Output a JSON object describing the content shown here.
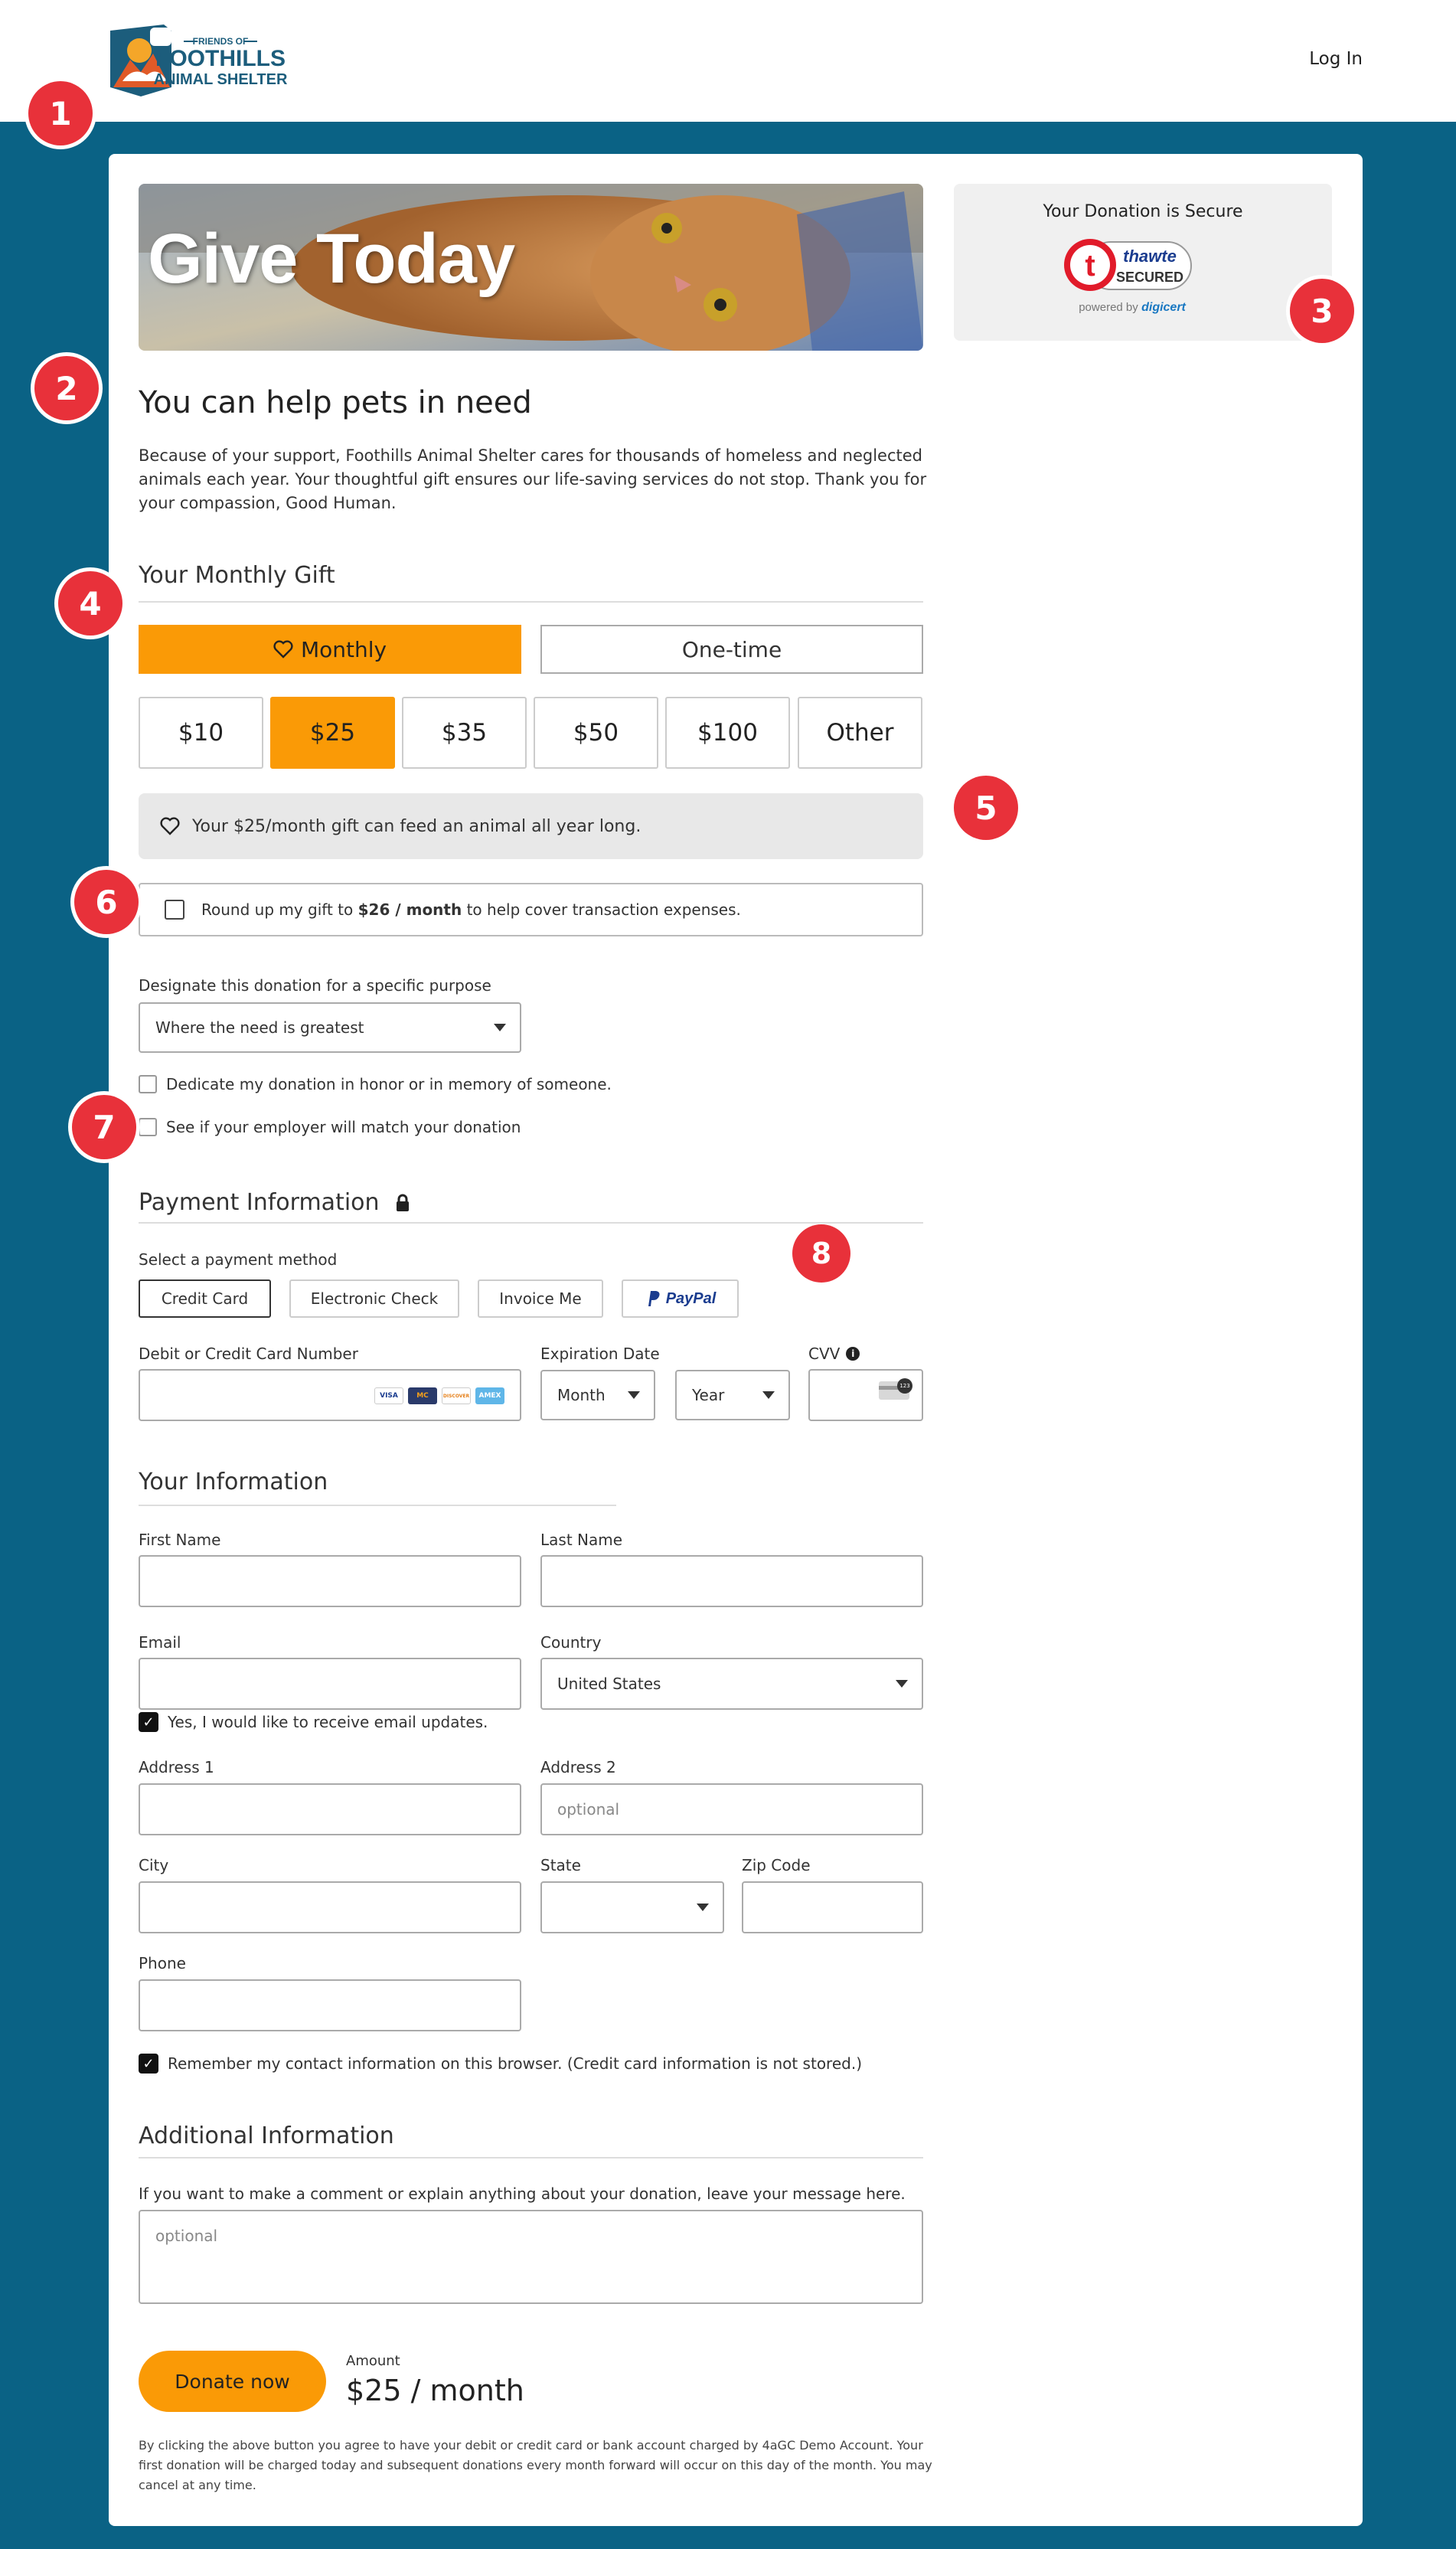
{
  "header": {
    "logo_small": "FRIENDS OF",
    "logo_line1": "FOOTHILLS",
    "logo_line2": "ANIMAL SHELTER",
    "login": "Log In"
  },
  "markers": [
    "1",
    "2",
    "3",
    "4",
    "5",
    "6",
    "7",
    "8"
  ],
  "hero": {
    "title": "Give Today"
  },
  "secure": {
    "title": "Your Donation is Secure",
    "seal_brand": "thawte",
    "seal_status": "SECURED",
    "seal_powered": "powered by",
    "seal_vendor": "digicert"
  },
  "intro": {
    "heading": "You can help pets in need",
    "text": "Because of your support, Foothills Animal Shelter cares for thousands of homeless and neglected animals each year. Your thoughtful gift ensures our life-saving services do not stop. Thank you for your compassion, Good Human."
  },
  "gift": {
    "heading": "Your Monthly Gift",
    "monthly": "Monthly",
    "onetime": "One-time",
    "amounts": [
      "$10",
      "$25",
      "$35",
      "$50",
      "$100",
      "Other"
    ],
    "impact": "Your $25/month gift can feed an animal all year long.",
    "roundup_pre": "Round up my gift to ",
    "roundup_bold": "$26 / month",
    "roundup_post": " to help cover transaction expenses.",
    "designate_label": "Designate this donation for a specific purpose",
    "designate_value": "Where the need is greatest",
    "dedicate": "Dedicate my donation in honor or in memory of someone.",
    "employer": "See if your employer will match your donation"
  },
  "payment": {
    "heading": "Payment Information",
    "method_label": "Select a payment method",
    "methods": [
      "Credit Card",
      "Electronic Check",
      "Invoice Me",
      "PayPal"
    ],
    "card_label": "Debit or Credit Card Number",
    "card_brands": [
      "VISA",
      "MC",
      "DISCOVER",
      "AMEX"
    ],
    "exp_label": "Expiration Date",
    "month": "Month",
    "year": "Year",
    "cvv_label": "CVV",
    "cvv_badge": "123"
  },
  "info": {
    "heading": "Your Information",
    "first": "First Name",
    "last": "Last Name",
    "email": "Email",
    "country": "Country",
    "country_value": "United States",
    "email_updates": "Yes, I would like to receive email updates.",
    "address1": "Address 1",
    "address2": "Address 2",
    "address2_placeholder": "optional",
    "city": "City",
    "state": "State",
    "zip": "Zip Code",
    "phone": "Phone",
    "remember": "Remember my contact information on this browser. (Credit card information is not stored.)"
  },
  "additional": {
    "heading": "Additional Information",
    "prompt": "If you want to make a comment or explain anything about your donation, leave your message here.",
    "placeholder": "optional"
  },
  "footer": {
    "donate": "Donate now",
    "amount_label": "Amount",
    "amount_value": "$25 / month",
    "fine": "By clicking the above button you agree to have your debit or credit card or bank account charged by 4aGC Demo Account. Your first donation will be charged today and subsequent donations every month forward will occur on this day of the month. You may cancel at any time."
  },
  "colors": {
    "page_bg": "#0a6285",
    "accent": "#fa9a06",
    "marker": "#e8313a"
  }
}
